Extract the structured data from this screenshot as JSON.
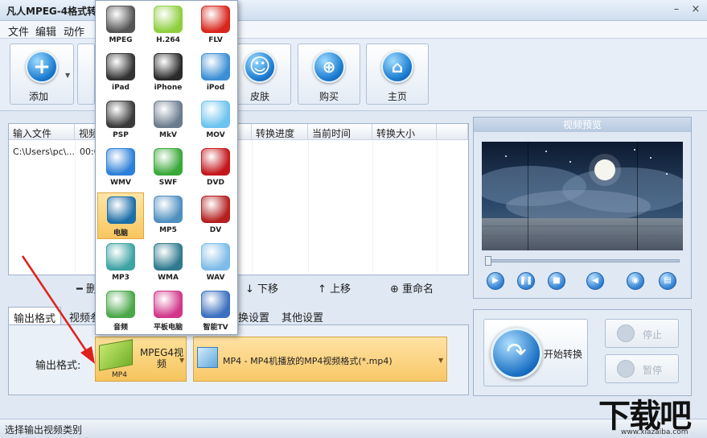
{
  "window": {
    "title": "凡人MPEG-4格式转"
  },
  "menu": [
    "文件",
    "编辑",
    "动作"
  ],
  "toolbar": {
    "add_label": "添加",
    "skin_label": "皮肤",
    "buy_label": "购买",
    "home_label": "主页"
  },
  "filelist": {
    "columns": [
      "输入文件",
      "视频",
      "转换进度",
      "当前时间",
      "转换大小"
    ],
    "rows": [
      {
        "file": "C:\\Users\\pc\\...",
        "video": "00:0"
      }
    ]
  },
  "actions": {
    "delete": "删",
    "down": "下移",
    "up": "上移",
    "rename": "重命名"
  },
  "preview": {
    "title": "视频预览",
    "controls": [
      "play",
      "pause",
      "stop",
      "volume",
      "snapshot",
      "folder"
    ]
  },
  "tabs": [
    "输出格式",
    "视频参",
    "换设置",
    "其他设置"
  ],
  "output": {
    "label": "输出格式:",
    "category_label": "MPEG4视频",
    "category_short": "MP4",
    "format_select": "MP4 - MP4机播放的MP4视频格式(*.mp4)"
  },
  "convert": {
    "start": "开始转换",
    "stop": "停止",
    "pause": "暂停"
  },
  "status": "选择输出视频类别",
  "watermark": {
    "text": "下载吧",
    "url_text": "www.xiazaiba.com"
  },
  "popup_items": [
    {
      "label": "MPEG",
      "icon": "film-reel-icon",
      "color": "#555555"
    },
    {
      "label": "H.264",
      "icon": "green-box-icon",
      "color": "#8fcf3f"
    },
    {
      "label": "FLV",
      "icon": "flash-icon",
      "color": "#d8261c"
    },
    {
      "label": "iPad",
      "icon": "ipad-icon",
      "color": "#333333"
    },
    {
      "label": "iPhone",
      "icon": "iphone-icon",
      "color": "#2a2a2a"
    },
    {
      "label": "iPod",
      "icon": "ipod-icon",
      "color": "#3c8fd6"
    },
    {
      "label": "PSP",
      "icon": "psp-icon",
      "color": "#3a3a3a"
    },
    {
      "label": "MkV",
      "icon": "film-icon",
      "color": "#6b7c8f"
    },
    {
      "label": "MOV",
      "icon": "quicktime-icon",
      "color": "#6cc3ef"
    },
    {
      "label": "WMV",
      "icon": "play-circle-icon",
      "color": "#2c7fd8"
    },
    {
      "label": "SWF",
      "icon": "swf-icon",
      "color": "#39a839"
    },
    {
      "label": "DVD",
      "icon": "dvd-icon",
      "color": "#c4161c"
    },
    {
      "label": "电脑",
      "icon": "monitor-icon",
      "color": "#1c6ea8"
    },
    {
      "label": "MP5",
      "icon": "mp5-icon",
      "color": "#4f8fc0"
    },
    {
      "label": "DV",
      "icon": "camcorder-icon",
      "color": "#b41f1f"
    },
    {
      "label": "MP3",
      "icon": "mp3-icon",
      "color": "#3da3a3"
    },
    {
      "label": "WMA",
      "icon": "music-folder-icon",
      "color": "#2f7a8f"
    },
    {
      "label": "WAV",
      "icon": "music-note-icon",
      "color": "#7dbbe8"
    },
    {
      "label": "音频",
      "icon": "audio-icon",
      "color": "#4aa84a"
    },
    {
      "label": "平板电脑",
      "icon": "tablet-icon",
      "color": "#d2368a"
    },
    {
      "label": "智能TV",
      "icon": "tv-icon",
      "color": "#3b6fbf"
    }
  ],
  "selected_popup_item": "电脑"
}
